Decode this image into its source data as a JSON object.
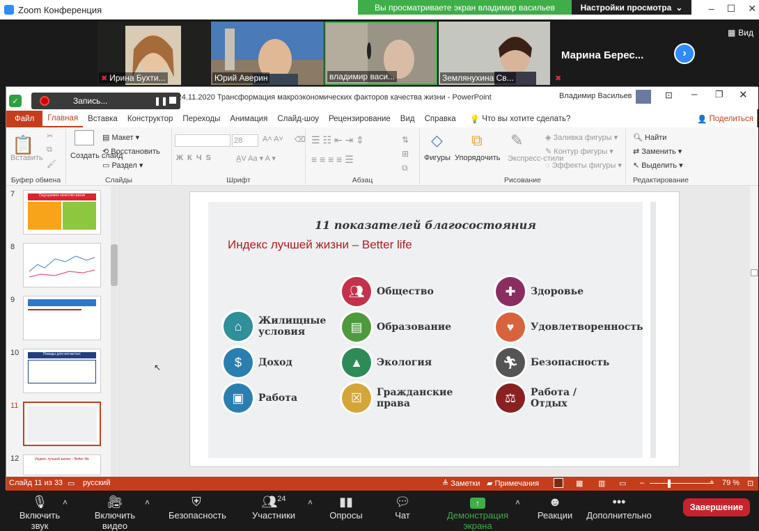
{
  "zoom": {
    "title": "Zoom Конференция",
    "share_banner": "Вы просматриваете экран владимир васильев",
    "view_options": "Настройки просмотра",
    "view_button": "Вид",
    "participants": [
      {
        "name": "Ирина Бухти..."
      },
      {
        "name": "Юрий Аверин"
      },
      {
        "name": "владимир васи..."
      },
      {
        "name": "Землянухина Св..."
      },
      {
        "name": "Марина  Берес..."
      }
    ],
    "toolbar": {
      "unmute": "Включить звук",
      "start_video": "Включить видео",
      "security": "Безопасность",
      "participants": "Участники",
      "participant_count": "24",
      "polls": "Опросы",
      "chat": "Чат",
      "share": "Демонстрация экрана",
      "reactions": "Реакции",
      "more": "Дополнительно",
      "end": "Завершение"
    }
  },
  "ppt": {
    "record": "Запись...",
    "doc_title": "Доклад 24.11.2020  Трансформация макроэкономических факторов качества жизни  -  PowerPoint",
    "user": "Владимир Васильев",
    "menu": [
      "Файл",
      "Главная",
      "Вставка",
      "Конструктор",
      "Переходы",
      "Анимация",
      "Слайд-шоу",
      "Рецензирование",
      "Вид",
      "Справка"
    ],
    "tell_me": "Что вы хотите сделать?",
    "share": "Поделиться",
    "ribbon": {
      "paste": "Вставить",
      "clipboard": "Буфер обмена",
      "create_slide": "Создать слайд",
      "layout": "Макет",
      "reset": "Восстановить",
      "section": "Раздел",
      "slides": "Слайды",
      "font_size": "28",
      "font": "Шрифт",
      "paragraph": "Абзац",
      "shapes": "Фигуры",
      "arrange": "Упорядочить",
      "express": "Экспресс-стили",
      "fill": "Заливка фигуры",
      "outline": "Контур фигуры",
      "effects": "Эффекты фигуры",
      "drawing": "Рисование",
      "find": "Найти",
      "replace": "Заменить",
      "select": "Выделить",
      "editing": "Редактирование"
    },
    "thumbs": [
      "7",
      "8",
      "9",
      "10",
      "11",
      "12"
    ],
    "thumb_titles": {
      "t7": "Ощущаемое качество жизни",
      "t10": "Поводы для несчастья:",
      "t12": "Индекс лучшей жизни – Better life"
    },
    "status": {
      "slide": "Слайд 11 из 33",
      "lang": "русский",
      "notes": "Заметки",
      "comments": "Примечания",
      "zoom": "79 %"
    },
    "slide": {
      "title": "11 показателей благосостояния",
      "subtitle": "Индекс лучшей жизни – Better life",
      "items": [
        {
          "label": "Жилищные условия",
          "color": "#2f8f9a",
          "icon": "house-icon"
        },
        {
          "label": "Доход",
          "color": "#2b7fb0",
          "icon": "money-icon"
        },
        {
          "label": "Работа",
          "color": "#2b7fb0",
          "icon": "briefcase-icon"
        },
        {
          "label": "Общество",
          "color": "#c4314b",
          "icon": "people-icon"
        },
        {
          "label": "Образование",
          "color": "#4e9a3c",
          "icon": "book-icon"
        },
        {
          "label": "Экология",
          "color": "#2e8b57",
          "icon": "tree-icon"
        },
        {
          "label": "Гражданские права",
          "color": "#d4a63a",
          "icon": "cross-box-icon"
        },
        {
          "label": "Здоровье",
          "color": "#8a2e62",
          "icon": "health-cross-icon"
        },
        {
          "label": "Удовлетворенность",
          "color": "#d7643c",
          "icon": "heart-icon"
        },
        {
          "label": "Безопасность",
          "color": "#555555",
          "icon": "runner-icon"
        },
        {
          "label": "Работа / Отдых",
          "color": "#8a2020",
          "icon": "scales-icon"
        }
      ]
    }
  }
}
